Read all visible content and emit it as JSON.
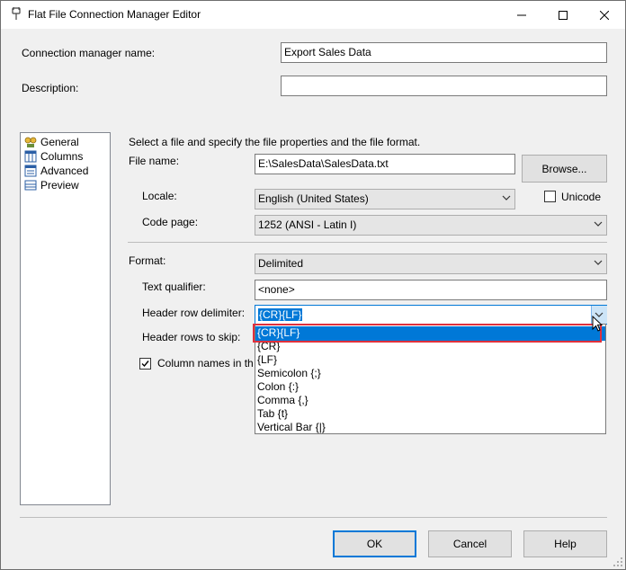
{
  "window": {
    "title": "Flat File Connection Manager Editor",
    "controls": {
      "minimize": "minimize",
      "maximize": "maximize",
      "close": "close"
    }
  },
  "header": {
    "conn_name_label": "Connection manager name:",
    "conn_name_value": "Export Sales Data",
    "description_label": "Description:",
    "description_value": ""
  },
  "nav": {
    "items": [
      {
        "label": "General",
        "icon": "general-icon",
        "selected": true
      },
      {
        "label": "Columns",
        "icon": "columns-icon"
      },
      {
        "label": "Advanced",
        "icon": "advanced-icon"
      },
      {
        "label": "Preview",
        "icon": "preview-icon"
      }
    ]
  },
  "general": {
    "intro": "Select a file and specify the file properties and the file format.",
    "file_name_label": "File name:",
    "file_name_value": "E:\\SalesData\\SalesData.txt",
    "browse_label": "Browse...",
    "locale_label": "Locale:",
    "locale_value": "English (United States)",
    "unicode_label": "Unicode",
    "unicode_checked": false,
    "code_page_label": "Code page:",
    "code_page_value": "1252  (ANSI - Latin I)",
    "format_label": "Format:",
    "format_value": "Delimited",
    "text_qualifier_label": "Text qualifier:",
    "text_qualifier_value": "<none>",
    "header_row_delim_label": "Header row delimiter:",
    "header_row_delim_value": "{CR}{LF}",
    "header_rows_skip_label": "Header rows to skip:",
    "column_names_label": "Column names in th",
    "column_names_checked": true
  },
  "dropdown": {
    "options": [
      "{CR}{LF}",
      "{CR}",
      "{LF}",
      "Semicolon {;}",
      "Colon {:}",
      "Comma {,}",
      "Tab {t}",
      "Vertical Bar {|}"
    ],
    "selected_index": 0,
    "highlight_color": "#0078d7",
    "callout_color": "#e0303c"
  },
  "footer": {
    "ok_label": "OK",
    "cancel_label": "Cancel",
    "help_label": "Help"
  }
}
